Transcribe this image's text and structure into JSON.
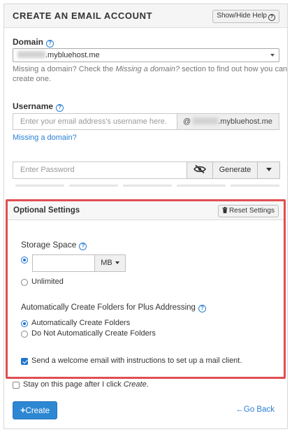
{
  "header": {
    "title": "CREATE AN EMAIL ACCOUNT",
    "help_button": "Show/Hide Help"
  },
  "domain": {
    "label": "Domain",
    "selected_suffix": ".mybluehost.me",
    "help_line1": "Missing a domain? Check the ",
    "help_italic": "Missing a domain?",
    "help_line1_end": " section to find out how you can",
    "help_line2": "create one."
  },
  "username": {
    "label": "Username",
    "placeholder": "Enter your email address's username here.",
    "at_prefix": "@",
    "domain_suffix": ".mybluehost.me",
    "missing_link": "Missing a domain?"
  },
  "password": {
    "placeholder": "Enter Password",
    "generate_label": "Generate",
    "toggle_icon": "eye-slash-icon"
  },
  "optional": {
    "title": "Optional Settings",
    "reset_label": "Reset Settings",
    "storage_label": "Storage Space",
    "storage_value": "",
    "unit_label": "MB",
    "storage_option_selected": "custom",
    "unlimited_label": "Unlimited",
    "plus_title": "Automatically Create Folders for Plus Addressing",
    "plus_option_auto": "Automatically Create Folders",
    "plus_option_none": "Do Not Automatically Create Folders",
    "plus_selected": "auto",
    "welcome_label": "Send a welcome email with instructions to set up a mail client.",
    "welcome_checked": true
  },
  "footer": {
    "stay_text": "Stay on this page after I click ",
    "stay_italic": "Create",
    "stay_end": ".",
    "stay_checked": false,
    "create_label": "Create",
    "goback_label": "Go Back"
  },
  "colors": {
    "accent": "#2a7fd4",
    "highlight_border": "#e14e52",
    "primary_button": "#2e87d3"
  }
}
